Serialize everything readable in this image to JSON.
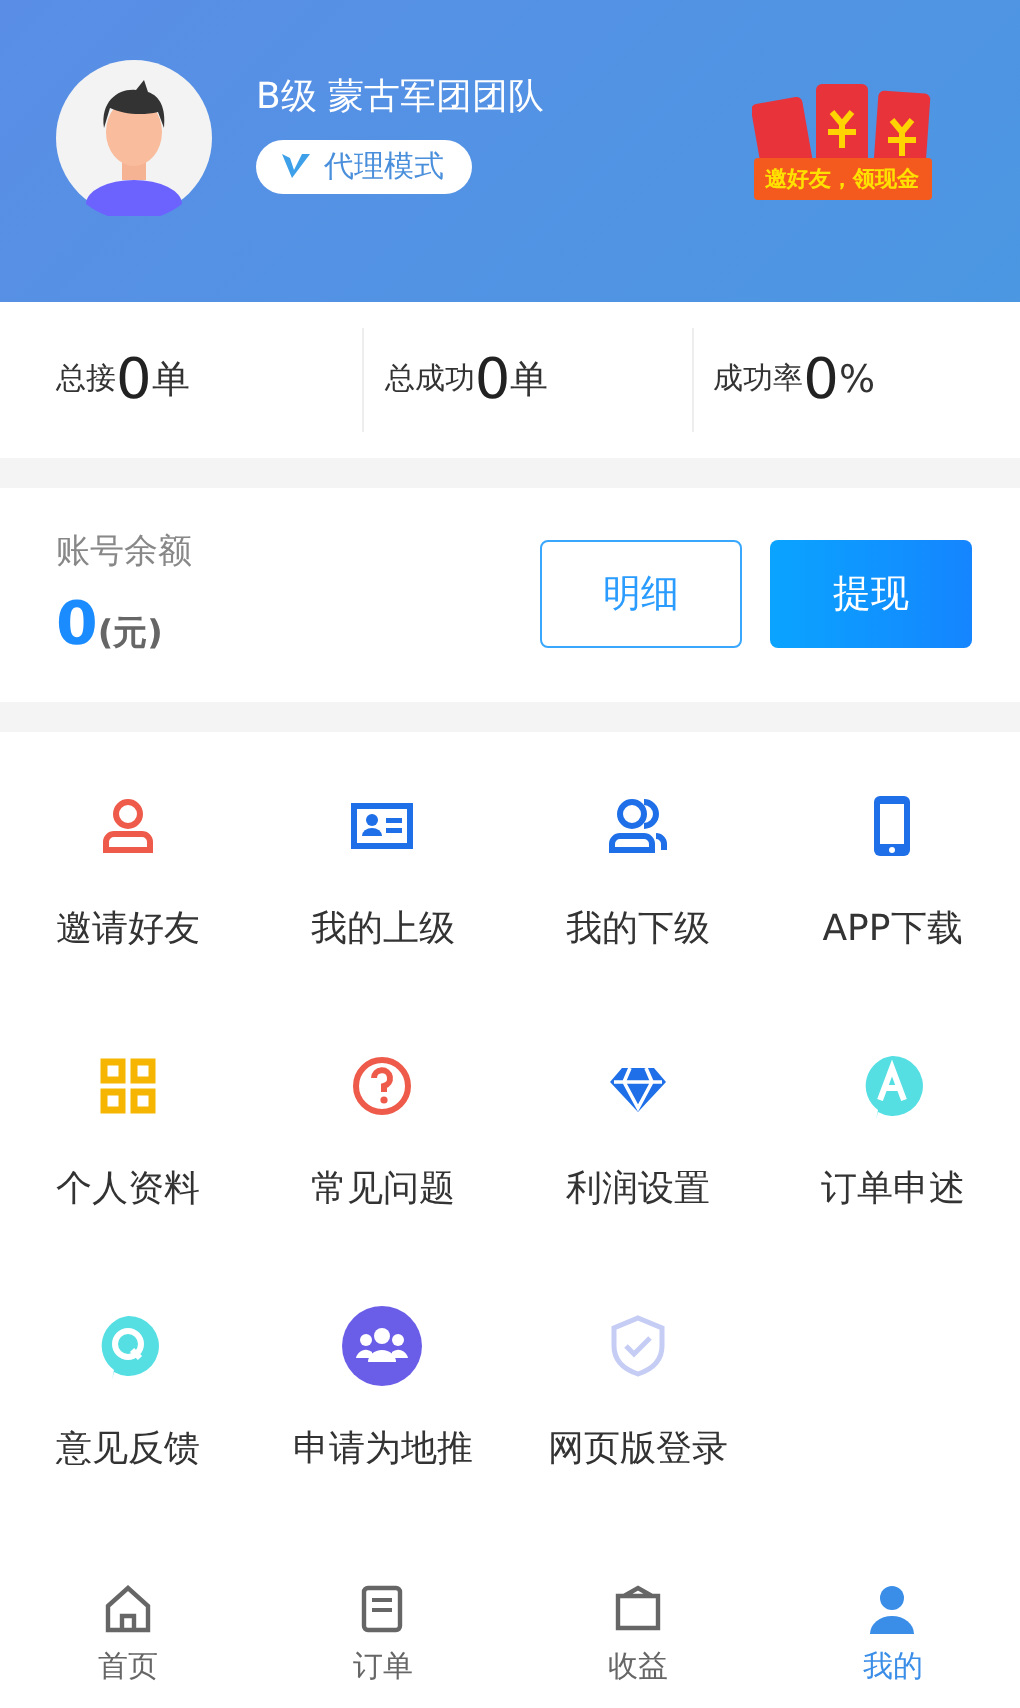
{
  "profile": {
    "name": "B级 蒙古军团团队",
    "mode_badge": "代理模式",
    "promo_banner": "邀好友，领现金"
  },
  "stats": [
    {
      "label": "总接",
      "value": "0",
      "unit": "单"
    },
    {
      "label": "总成功",
      "value": "0",
      "unit": "单"
    },
    {
      "label": "成功率",
      "value": "0",
      "unit": "%"
    }
  ],
  "balance": {
    "label": "账号余额",
    "amount": "0",
    "unit": "(元)",
    "buttons": [
      {
        "label": "明细",
        "kind": "outline"
      },
      {
        "label": "提现",
        "kind": "filled"
      }
    ]
  },
  "menu": [
    {
      "label": "邀请好友"
    },
    {
      "label": "我的上级"
    },
    {
      "label": "我的下级"
    },
    {
      "label": "APP下载"
    },
    {
      "label": "个人资料"
    },
    {
      "label": "常见问题"
    },
    {
      "label": "利润设置"
    },
    {
      "label": "订单申述"
    },
    {
      "label": "意见反馈"
    },
    {
      "label": "申请为地推"
    },
    {
      "label": "网页版登录"
    }
  ],
  "tabbar": [
    {
      "label": "首页",
      "selected": false
    },
    {
      "label": "订单",
      "selected": false
    },
    {
      "label": "收益",
      "selected": false
    },
    {
      "label": "我的",
      "selected": true
    }
  ]
}
